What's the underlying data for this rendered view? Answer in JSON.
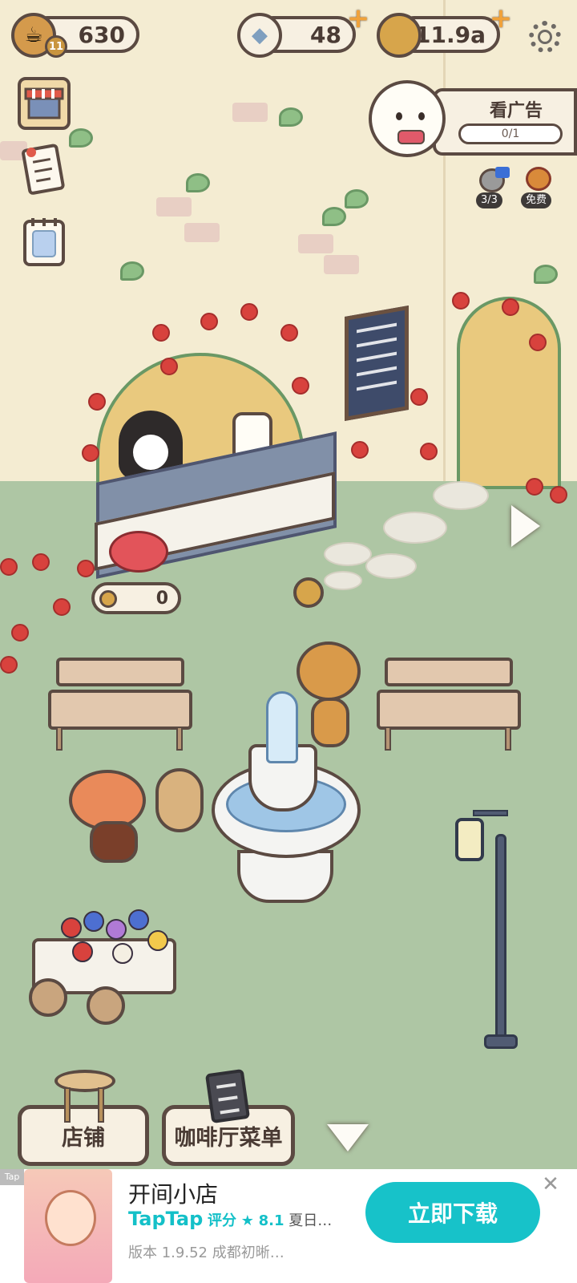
{
  "hud": {
    "cups": "630",
    "level": "11",
    "diamonds": "48",
    "coins": "11.9a"
  },
  "watch_ad": {
    "title": "看广告",
    "progress": "0/1",
    "progress_fraction": 0
  },
  "badges": {
    "boost_count": "3/3",
    "free_label": "免费"
  },
  "tip_jar": {
    "value": "0"
  },
  "bottom_bar": {
    "shop_label": "店铺",
    "menu_label": "咖啡厅菜单"
  },
  "ad_banner": {
    "corner_tag": "Tap",
    "app_title": "开间小店",
    "platform": "TapTap",
    "rating_label": "评分",
    "rating_star": "★",
    "rating_value": "8.1",
    "tagline": "夏日…",
    "version": "版本 1.9.52",
    "developer": "成都初晰…",
    "download_label": "立即下载",
    "close_symbol": "✕"
  },
  "icons": {
    "cup": "coffee-cup-icon",
    "diamond": "diamond-icon",
    "coin": "coin-icon",
    "settings": "gear-icon",
    "shop": "shop-awning-icon",
    "tasks": "task-list-icon",
    "calendar": "calendar-icon"
  },
  "colors": {
    "outline": "#5b4a42",
    "panel": "#f7f0e2",
    "grass": "#aec6a4",
    "wall": "#f4ecd2",
    "accent_plus": "#f0a23a",
    "ad_button": "#17c2c9"
  }
}
